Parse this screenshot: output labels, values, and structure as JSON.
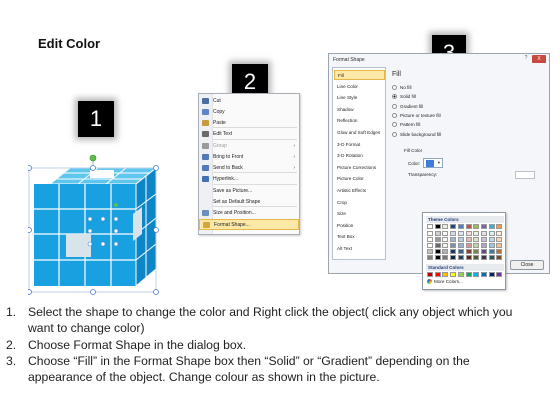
{
  "title": "Edit Color",
  "badges": [
    "1",
    "2",
    "3"
  ],
  "context_menu": {
    "items": [
      {
        "label": "Cut",
        "icon": "scissors-icon",
        "color": "#4a6fa5",
        "underline": true
      },
      {
        "label": "Copy",
        "icon": "copy-icon",
        "color": "#5b87c7",
        "underline": true
      },
      {
        "label": "Paste",
        "icon": "paste-icon",
        "color": "#c79a3c",
        "underline": true
      },
      {
        "label": "Edit Text",
        "icon": "edit-text-icon",
        "color": "#6a6a6a"
      },
      {
        "label": "Group",
        "icon": "group-icon",
        "color": "#9a9a9a",
        "submenu": true,
        "dim": true
      },
      {
        "label": "Bring to Front",
        "icon": "bring-front-icon",
        "color": "#4f79b8",
        "submenu": true
      },
      {
        "label": "Send to Back",
        "icon": "send-back-icon",
        "color": "#4f79b8",
        "submenu": true
      },
      {
        "label": "Hyperlink...",
        "icon": "hyperlink-icon",
        "color": "#3d6fb5"
      },
      {
        "label": "Save as Picture...",
        "icon": "",
        "color": ""
      },
      {
        "label": "Set as Default Shape",
        "icon": "",
        "color": ""
      },
      {
        "label": "Size and Position...",
        "icon": "size-position-icon",
        "color": "#6b8fbf"
      },
      {
        "label": "Format Shape...",
        "icon": "format-shape-icon",
        "color": "#d9a53a",
        "selected": true
      }
    ]
  },
  "dialog": {
    "title": "Format Shape",
    "help": "?",
    "close": "X",
    "nav": [
      "Fill",
      "Line Color",
      "Line Style",
      "Shadow",
      "Reflection",
      "Glow and Soft Edges",
      "3-D Format",
      "3-D Rotation",
      "Picture Corrections",
      "Picture Color",
      "Artistic Effects",
      "Crop",
      "Size",
      "Position",
      "Text Box",
      "Alt Text"
    ],
    "nav_selected": "Fill",
    "section_title": "Fill",
    "fill_options": [
      {
        "label": "No fill",
        "checked": false
      },
      {
        "label": "Solid fill",
        "checked": true
      },
      {
        "label": "Gradient fill",
        "checked": false
      },
      {
        "label": "Picture or texture fill",
        "checked": false
      },
      {
        "label": "Pattern fill",
        "checked": false
      },
      {
        "label": "Slide background fill",
        "checked": false
      }
    ],
    "fill_color_label": "Fill Color",
    "color_label": "Color:",
    "transparency_label": "Transparency:",
    "palette": {
      "theme_header": "Theme Colors",
      "standard_header": "Standard Colors",
      "more_colors": "More Colors...",
      "theme_top": [
        "#ffffff",
        "#000000",
        "#eeece1",
        "#1f497d",
        "#4f81bd",
        "#c0504d",
        "#9bbb59",
        "#8064a2",
        "#4bacc6",
        "#f79646"
      ],
      "standard": [
        "#c00000",
        "#ff0000",
        "#ffc000",
        "#ffff00",
        "#92d050",
        "#00b050",
        "#00b0f0",
        "#0070c0",
        "#002060",
        "#7030a0"
      ]
    },
    "close_button": "Close"
  },
  "instructions": [
    {
      "num": "1.",
      "lines": [
        "Select the shape to change the color and Right click the object( click any object which you",
        "want to change color)"
      ]
    },
    {
      "num": "2.",
      "lines": [
        "Choose Format Shape in the dialog box."
      ]
    },
    {
      "num": "3.",
      "lines": [
        "Choose “Fill” in the Format Shape box then “Solid” or “Gradient” depending on the",
        "appearance of the object. Change colour as shown in the picture."
      ]
    }
  ],
  "colors": {
    "cube_top": "#5fc6ee",
    "cube_front": "#18a0e0",
    "cube_side": "#0c86c6",
    "handle": "#4a7bd0",
    "rotate_handle": "#5bbf4a"
  }
}
